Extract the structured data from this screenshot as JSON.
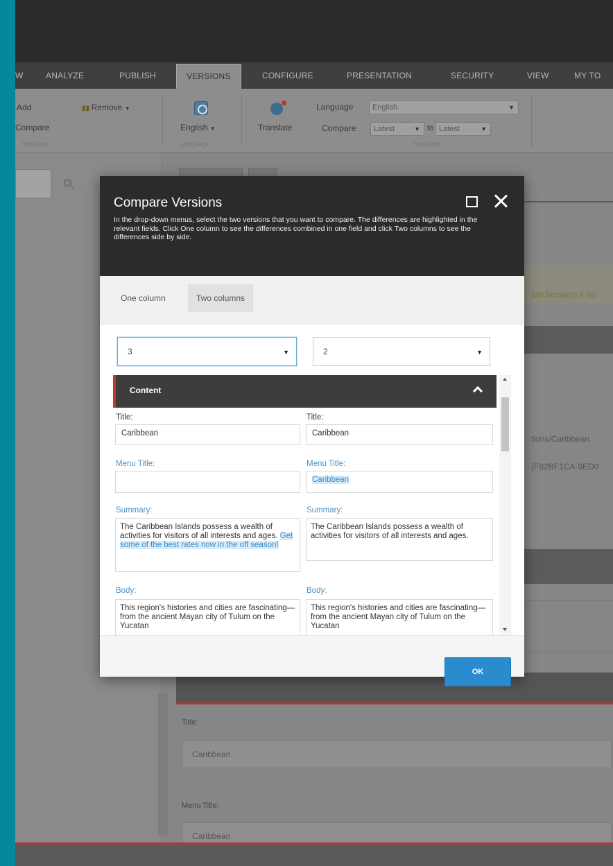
{
  "nav": {
    "tabs": [
      {
        "label": "W"
      },
      {
        "label": "ANALYZE"
      },
      {
        "label": "PUBLISH"
      },
      {
        "label": "VERSIONS"
      },
      {
        "label": "CONFIGURE"
      },
      {
        "label": "PRESENTATION"
      },
      {
        "label": "SECURITY"
      },
      {
        "label": "VIEW"
      },
      {
        "label": "MY TO"
      }
    ],
    "active_tab": "VERSIONS"
  },
  "ribbon": {
    "add_label": "Add",
    "compare_label": "Compare",
    "versions_caption": "Versions",
    "remove_label": "Remove",
    "english_label": "English",
    "language_caption": "Language",
    "translate_label": "Translate",
    "language_field_label": "Language",
    "language_value": "English",
    "compare_field_label": "Compare",
    "compare_from": "Latest",
    "to_label": "to",
    "compare_to": "Latest",
    "translate_caption": "Translate"
  },
  "background": {
    "warning_text": "ails because it ha",
    "path_text": "tions/Caribbean",
    "id_text": "{F82BF1CA-9ED0",
    "title_label": "Title:",
    "title_value": "Caribbean",
    "menu_title_label": "Menu Title:",
    "menu_title_value": "Caribbean"
  },
  "dialog": {
    "title": "Compare Versions",
    "description": "In the drop-down menus, select the two versions that you want to compare. The differences are highlighted in the relevant fields. Click One column to see the differences combined in one field and click Two columns to see the differences side by side.",
    "view_tabs": {
      "one_column": "One column",
      "two_columns": "Two columns",
      "active": "Two columns"
    },
    "left_version": "3",
    "right_version": "2",
    "section_title": "Content",
    "left": {
      "title_label": "Title:",
      "title_value": "Caribbean",
      "menu_title_label": "Menu Title:",
      "menu_title_value": "",
      "summary_label": "Summary:",
      "summary_text": "The Caribbean Islands possess a wealth of activities for visitors of all interests and ages.",
      "summary_added": "Get some of the best rates now in the off season!",
      "body_label": "Body:",
      "body_text": "This region's histories and cities are fascinating—from the ancient Mayan city of Tulum on the Yucatan"
    },
    "right": {
      "title_label": "Title:",
      "title_value": "Caribbean",
      "menu_title_label": "Menu Title:",
      "menu_title_value": "Caribbean",
      "summary_label": "Summary:",
      "summary_text": "The Caribbean Islands possess a wealth of activities for visitors of all interests and ages.",
      "body_label": "Body:",
      "body_text": "This region's histories and cities are fascinating—from the ancient Mayan city of Tulum on the Yucatan"
    },
    "ok_label": "OK"
  }
}
